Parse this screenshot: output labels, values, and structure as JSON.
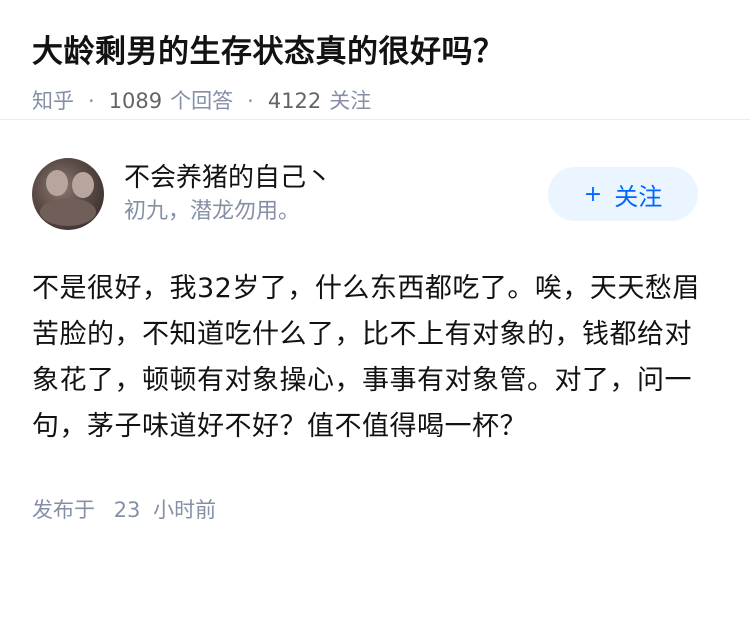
{
  "question": {
    "title": "大龄剩男的生存状态真的很好吗？",
    "source": "知乎",
    "separator": "·",
    "answers_count": "1089",
    "answers_label": "个回答",
    "followers_count": "4122",
    "followers_label": "关注"
  },
  "answer": {
    "author": {
      "name": "不会养猪的自己丶",
      "bio": "初九，潜龙勿用。",
      "avatar_icon": "avatar-photo"
    },
    "follow_button": {
      "icon": "plus-icon",
      "plus_glyph": "+",
      "label": "关注"
    },
    "content": "不是很好，我32岁了，什么东西都吃了。唉，天天愁眉苦脸的，不知道吃什么了，比不上有对象的，钱都给对象花了，顿顿有对象操心，事事有对象管。对了，问一句，茅子味道好不好？值不值得喝一杯？",
    "time_prefix": "发布于",
    "time_value": "23",
    "time_suffix": "小时前"
  },
  "colors": {
    "meta": "#8590a6",
    "accent": "#0066ff",
    "follow_bg": "#ebf5ff"
  }
}
